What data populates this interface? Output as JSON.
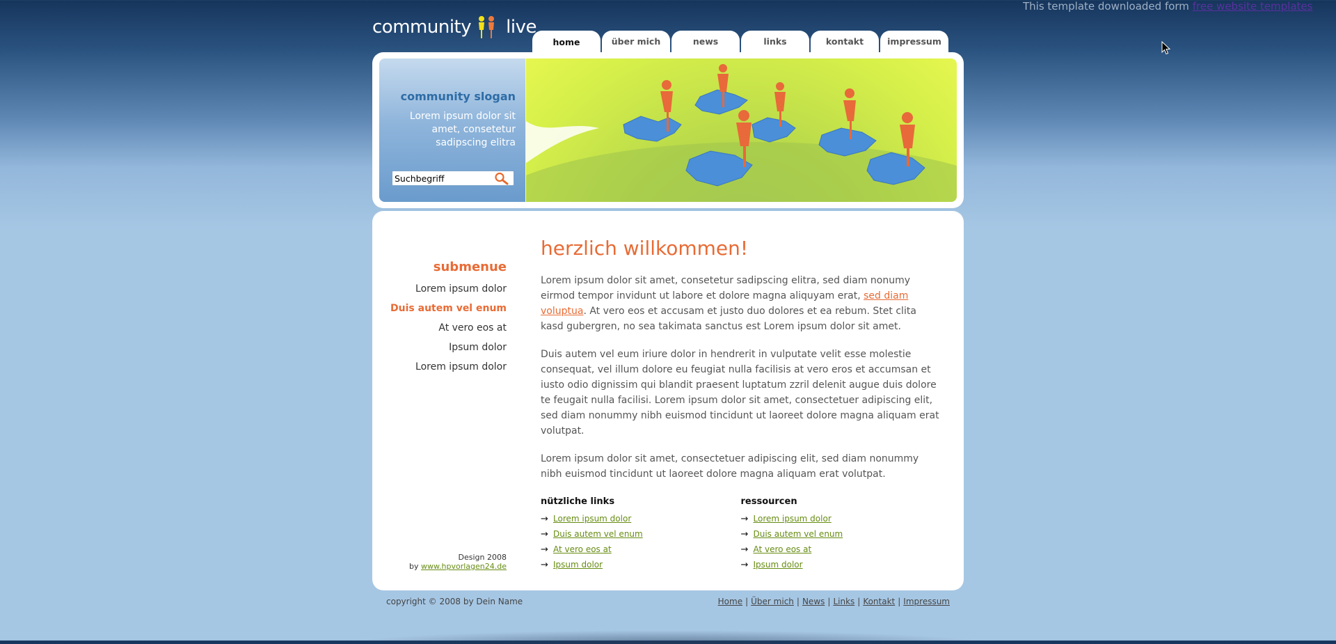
{
  "credit": {
    "text": "This template downloaded form",
    "link_label": "free website templates"
  },
  "logo": {
    "word1": "community",
    "word2": "live"
  },
  "nav": {
    "tabs": [
      {
        "label": "home",
        "active": true
      },
      {
        "label": "über mich",
        "active": false
      },
      {
        "label": "news",
        "active": false
      },
      {
        "label": "links",
        "active": false
      },
      {
        "label": "kontakt",
        "active": false
      },
      {
        "label": "impressum",
        "active": false
      }
    ]
  },
  "header": {
    "slogan_title": "community slogan",
    "slogan_text": "Lorem ipsum dolor sit amet, consetetur sadipscing elitra",
    "search": {
      "value": "Suchbegriff"
    }
  },
  "sidebar": {
    "title": "submenue",
    "items": [
      {
        "label": "Lorem ipsum dolor",
        "active": false
      },
      {
        "label": "Duis autem vel enum",
        "active": true
      },
      {
        "label": "At vero eos at",
        "active": false
      },
      {
        "label": "Ipsum dolor",
        "active": false
      },
      {
        "label": "Lorem ipsum dolor",
        "active": false
      }
    ],
    "design_line": "Design 2008",
    "by_prefix": "by",
    "by_link": "www.hpvorlagen24.de"
  },
  "content": {
    "heading": "herzlich willkommen!",
    "p1_before": "Lorem ipsum dolor sit amet, consetetur sadipscing elitra, sed diam nonumy eirmod tempor invidunt ut labore et dolore magna aliquyam erat, ",
    "p1_link": "sed diam voluptua",
    "p1_after": ". At vero eos et accusam et justo duo dolores et ea rebum. Stet clita kasd gubergren, no sea takimata sanctus est Lorem ipsum dolor sit amet.",
    "p2": "Duis autem vel eum iriure dolor in hendrerit in vulputate velit esse molestie consequat, vel illum dolore eu feugiat nulla facilisis at vero eros et accumsan et iusto odio dignissim qui blandit praesent luptatum zzril delenit augue duis dolore te feugait nulla facilisi. Lorem ipsum dolor sit amet, consectetuer adipiscing elit, sed diam nonummy nibh euismod tincidunt ut laoreet dolore magna aliquam erat volutpat.",
    "p3": "Lorem ipsum dolor sit amet, consectetuer adipiscing elit, sed diam nonummy nibh euismod tincidunt ut laoreet dolore magna aliquam erat volutpat.",
    "links_col": {
      "title": "nützliche links",
      "items": [
        "Lorem ipsum dolor",
        "Duis autem vel enum",
        "At vero eos at",
        "Ipsum dolor"
      ]
    },
    "res_col": {
      "title": "ressourcen",
      "items": [
        "Lorem ipsum dolor",
        "Duis autem vel enum",
        "At vero eos at",
        "Ipsum dolor"
      ]
    },
    "arrow": "→"
  },
  "footer": {
    "copyright": "copyright © 2008 by Dein Name",
    "links": [
      "Home",
      "Über mich",
      "News",
      "Links",
      "Kontakt",
      "Impressum"
    ],
    "separator": "|"
  },
  "colors": {
    "accent_orange": "#e86b35",
    "link_green": "#668c12",
    "slogan_blue": "#2e6ca6"
  },
  "icons": {
    "search": "magnifier-icon",
    "logo_people": "people-icon",
    "cursor": "mouse-cursor-icon"
  }
}
